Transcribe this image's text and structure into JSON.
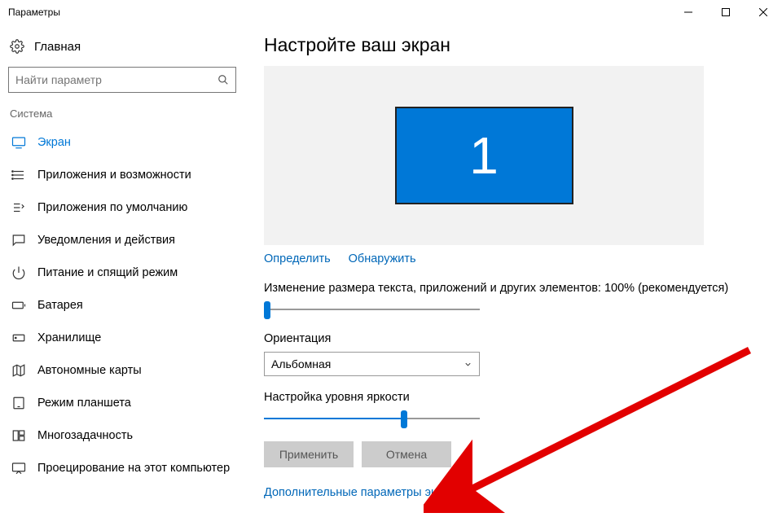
{
  "window": {
    "title": "Параметры"
  },
  "home": {
    "label": "Главная"
  },
  "search": {
    "placeholder": "Найти параметр"
  },
  "section": {
    "label": "Система"
  },
  "sidebar": {
    "items": [
      {
        "label": "Экран"
      },
      {
        "label": "Приложения и возможности"
      },
      {
        "label": "Приложения по умолчанию"
      },
      {
        "label": "Уведомления и действия"
      },
      {
        "label": "Питание и спящий режим"
      },
      {
        "label": "Батарея"
      },
      {
        "label": "Хранилище"
      },
      {
        "label": "Автономные карты"
      },
      {
        "label": "Режим планшета"
      },
      {
        "label": "Многозадачность"
      },
      {
        "label": "Проецирование на этот компьютер"
      }
    ]
  },
  "main": {
    "heading": "Настройте ваш экран",
    "monitor_label": "1",
    "identify": "Определить",
    "detect": "Обнаружить",
    "scale_label": "Изменение размера текста, приложений и других элементов: 100% (рекомендуется)",
    "orientation_label": "Ориентация",
    "orientation_value": "Альбомная",
    "brightness_label": "Настройка уровня яркости",
    "apply": "Применить",
    "cancel": "Отмена",
    "advanced": "Дополнительные параметры экрана"
  }
}
